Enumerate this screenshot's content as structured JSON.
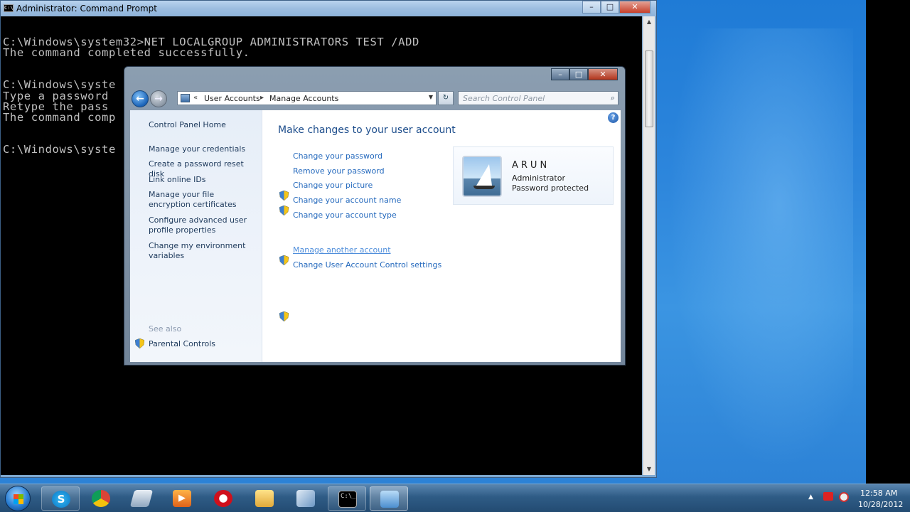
{
  "cmd": {
    "title": "Administrator: Command Prompt",
    "title_icon": "C:\\",
    "lines": [
      "C:\\Windows\\system32>NET LOCALGROUP ADMINISTRATORS TEST /ADD",
      "The command completed successfully.",
      "",
      "C:\\Windows\\syste",
      "Type a password",
      "Retype the pass",
      "The command comp",
      "",
      "C:\\Windows\\syste"
    ],
    "controls": {
      "minimize": "–",
      "maximize": "□",
      "close": "✕"
    }
  },
  "control_panel": {
    "controls": {
      "minimize": "–",
      "maximize": "□",
      "close": "✕"
    },
    "address": {
      "sep": "«",
      "part1": "User Accounts",
      "arrow": "▸",
      "part2": "Manage Accounts"
    },
    "search_placeholder": "Search Control Panel",
    "left_nav": [
      "Control Panel Home",
      "Manage your credentials",
      "Create a password reset disk",
      "Link online IDs",
      "Manage your file encryption certificates",
      "Configure advanced user profile properties",
      "Change my environment variables"
    ],
    "see_also": "See also",
    "parental_controls": "Parental Controls",
    "main_title": "Make changes to your user account",
    "links": [
      "Change your password",
      "Remove your password",
      "Change your picture",
      "Change your account name",
      "Change your account type",
      "Manage another account",
      "Change User Account Control settings"
    ],
    "account": {
      "name": "ARUN",
      "role": "Administrator",
      "status": "Password protected"
    },
    "help": "?"
  },
  "taskbar": {
    "apps": [
      "skype",
      "chrome",
      "windows-explorer-libraries",
      "media-player",
      "opera",
      "folder",
      "remote-desktop",
      "command-prompt",
      "control-panel"
    ],
    "clock_time": "12:58 AM",
    "clock_date": "10/28/2012"
  }
}
